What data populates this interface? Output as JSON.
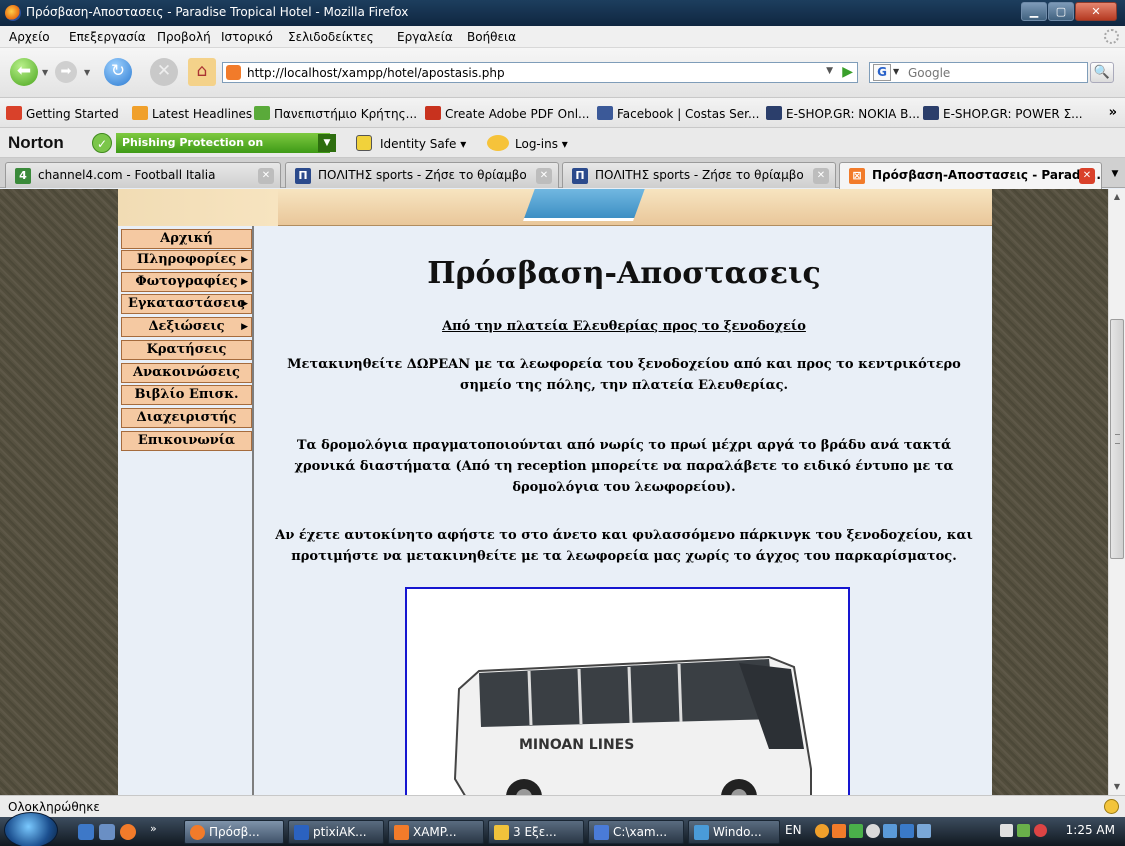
{
  "window": {
    "title": "Πρόσβαση-Αποστασεις - Paradise Tropical Hotel - Mozilla Firefox",
    "minimize": "▁",
    "maximize": "▢",
    "close": "✕"
  },
  "menubar": {
    "items": [
      "Αρχείο",
      "Επεξεργασία",
      "Προβολή",
      "Ιστορικό",
      "Σελιδοδείκτες",
      "Εργαλεία",
      "Βοήθεια"
    ]
  },
  "nav": {
    "url": "http://localhost/xampp/hotel/apostasis.php",
    "search_placeholder": "Google"
  },
  "bookmarks": {
    "items": [
      {
        "label": "Getting Started",
        "color": "#d9412a"
      },
      {
        "label": "Latest Headlines",
        "color": "#f0a02b"
      },
      {
        "label": "Πανεπιστήμιο Κρήτης...",
        "color": "#5aaa3a"
      },
      {
        "label": "Create Adobe PDF Onl...",
        "color": "#c8321e"
      },
      {
        "label": "Facebook | Costas Ser...",
        "color": "#3b5998"
      },
      {
        "label": "E-SHOP.GR: NOKIA B...",
        "color": "#2b3e6b"
      },
      {
        "label": "E-SHOP.GR: POWER Σ...",
        "color": "#2b3e6b"
      }
    ],
    "more": "»"
  },
  "norton": {
    "logo": "Norton",
    "phishing": "Phishing Protection on",
    "identity": "Identity Safe ▾",
    "logins": "Log-ins ▾"
  },
  "tabs": [
    {
      "label": "channel4.com - Football Italia",
      "icon": "4",
      "color": "#3a8a3a"
    },
    {
      "label": "ΠΟΛΙΤΗΣ sports - Ζήσε το θρίαμβο",
      "icon": "Π",
      "color": "#2b4a8c"
    },
    {
      "label": "ΠΟΛΙΤΗΣ sports - Ζήσε το θρίαμβο",
      "icon": "Π",
      "color": "#2b4a8c"
    },
    {
      "label": "Πρόσβαση-Αποστασεις - Paradis...",
      "icon": "⊠",
      "color": "#f27b2a"
    }
  ],
  "side_menu": [
    {
      "label": "Αρχική",
      "submenu": false
    },
    {
      "label": "Πληροφορίες",
      "submenu": true
    },
    {
      "label": "Φωτογραφίες",
      "submenu": true
    },
    {
      "label": "Εγκαταστάσεις",
      "submenu": true
    },
    {
      "label": "Δεξιώσεις",
      "submenu": true
    },
    {
      "label": "Κρατήσεις",
      "submenu": false
    },
    {
      "label": "Ανακοινώσεις",
      "submenu": false
    },
    {
      "label": "Βιβλίο Επισκ.",
      "submenu": false
    },
    {
      "label": "Διαχειριστής",
      "submenu": false
    },
    {
      "label": "Επικοινωνία",
      "submenu": false
    }
  ],
  "content": {
    "heading": "Πρόσβαση-Αποστασεις",
    "subheading": "Από την πλατεία Ελευθερίας προς το ξενοδοχείο",
    "para1": "Μετακινηθείτε ΔΩΡΕΑΝ με τα λεωφορεία του ξενοδοχείου από και προς το κεντρικότερο σημείο της πόλης, την πλατεία Ελευθερίας.",
    "para2": "Τα δρομολόγια πραγματοποιούνται από νωρίς το πρωί μέχρι αργά το βράδυ ανά τακτά χρονικά διαστήματα (Από τη reception μπορείτε να παραλάβετε το ειδικό έντυπο με τα δρομολόγια του λεωφορείου).",
    "para3": "Αν έχετε αυτοκίνητο αφήστε το στο άνετο και φυλασσόμενο πάρκινγκ του ξενοδοχείου, και προτιμήστε να μετακινηθείτε με τα λεωφορεία μας χωρίς το άγχος του παρκαρίσματος.",
    "bus_text": "MINOAN LINES"
  },
  "status": {
    "text": "Ολοκληρώθηκε"
  },
  "taskbar": {
    "buttons": [
      {
        "label": "Πρόσβ...",
        "color": "#f27b2a",
        "active": true
      },
      {
        "label": "ptixiAK...",
        "color": "#2b62c0",
        "active": false
      },
      {
        "label": "XAMP...",
        "color": "#f27b2a",
        "active": false
      },
      {
        "label": "3 Εξε...",
        "color": "#f0c23b",
        "active": false
      },
      {
        "label": "C:\\xam...",
        "color": "#4a7bd8",
        "active": false
      },
      {
        "label": "Windo...",
        "color": "#4a9bd8",
        "active": false
      }
    ],
    "lang": "EN",
    "clock": "1:25 AM"
  }
}
